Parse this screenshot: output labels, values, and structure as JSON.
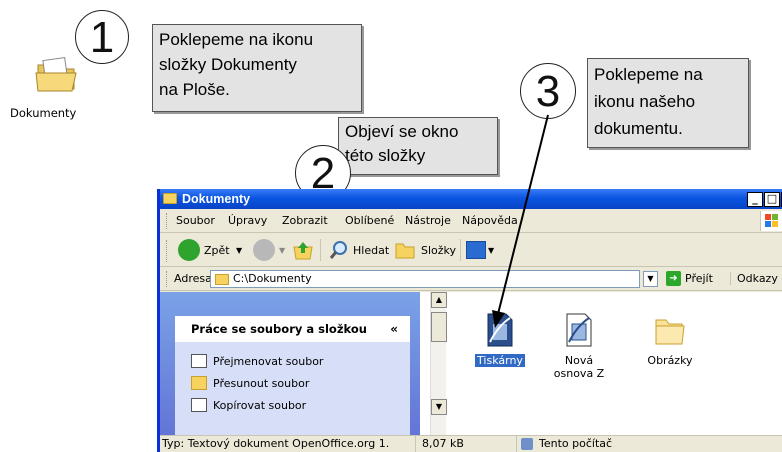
{
  "desktop": {
    "icon_label": "Dokumenty"
  },
  "callouts": {
    "step1": {
      "number": "1",
      "text": "Poklepeme na ikonu\nsložky Dokumenty\nna Ploše."
    },
    "step2": {
      "number": "2",
      "text": "Objeví se okno\ntéto složky"
    },
    "step3": {
      "number": "3",
      "text": "Poklepeme na\nikonu našeho\ndokumentu."
    }
  },
  "window": {
    "title": "Dokumenty",
    "controls": {
      "minimize": "_",
      "maximize": "□",
      "close": "x"
    },
    "menu": [
      "Soubor",
      "Úpravy",
      "Zobrazit",
      "Oblíbené",
      "Nástroje",
      "Nápověda"
    ],
    "toolbar": {
      "back": "Zpět",
      "search": "Hledat",
      "folders": "Složky"
    },
    "address": {
      "label": "Adresa",
      "value": "C:\\Dokumenty",
      "go": "Přejít",
      "links": "Odkazy"
    },
    "tasks": {
      "header": "Práce se soubory a složkou",
      "collapse": "«",
      "items": [
        "Přejmenovat soubor",
        "Přesunout soubor",
        "Kopírovat soubor"
      ]
    },
    "files": [
      {
        "name": "Tiskárny",
        "selected": true,
        "icon": "document-icon"
      },
      {
        "name": "Nová osnova Z",
        "selected": false,
        "icon": "document-icon"
      },
      {
        "name": "Obrázky",
        "selected": false,
        "icon": "folder-icon"
      }
    ],
    "status": {
      "type": "Typ: Textový dokument OpenOffice.org 1.",
      "size": "8,07 kB",
      "location": "Tento počítač"
    }
  },
  "colors": {
    "titlebar": "#0a55e0",
    "callout": "#e3e3e3",
    "selection": "#316ac5"
  }
}
